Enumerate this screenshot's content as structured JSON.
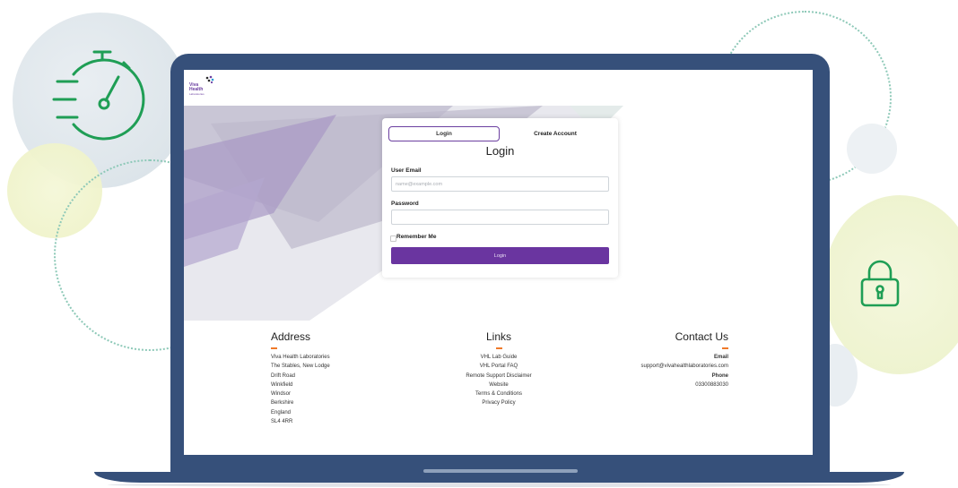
{
  "login_card": {
    "tab_login": "Login",
    "tab_create_account": "Create Account",
    "title": "Login",
    "email_label": "User Email",
    "email_placeholder": "name@example.com",
    "password_label": "Password",
    "remember_label": "Remember Me",
    "submit_label": "Login"
  },
  "logo": {
    "line1": "Viva",
    "line2": "Health",
    "line3": "Laboratories"
  },
  "footer": {
    "address": {
      "title": "Address",
      "lines": [
        "Viva Health Laboratories",
        "The Stables, New Lodge",
        "Drift Road",
        "Winkfield",
        "Windsor",
        "Berkshire",
        "England",
        "SL4 4RR"
      ]
    },
    "links": {
      "title": "Links",
      "items": [
        "VHL Lab Guide",
        "VHL Portal FAQ",
        "Remote Support Disclaimer",
        "Website",
        "Terms & Conditions",
        "Privacy Policy"
      ]
    },
    "contact": {
      "title": "Contact Us",
      "email_label": "Email",
      "email": "support@vivahealthlaboratories.com",
      "phone_label": "Phone",
      "phone": "03300883030"
    }
  },
  "colors": {
    "accent": "#6a35a0",
    "laptop": "#36507a",
    "icon_green": "#1f9e55",
    "dash_orange": "#f07a2a"
  },
  "icons": {
    "stopwatch": "stopwatch-icon",
    "padlock": "padlock-icon"
  }
}
